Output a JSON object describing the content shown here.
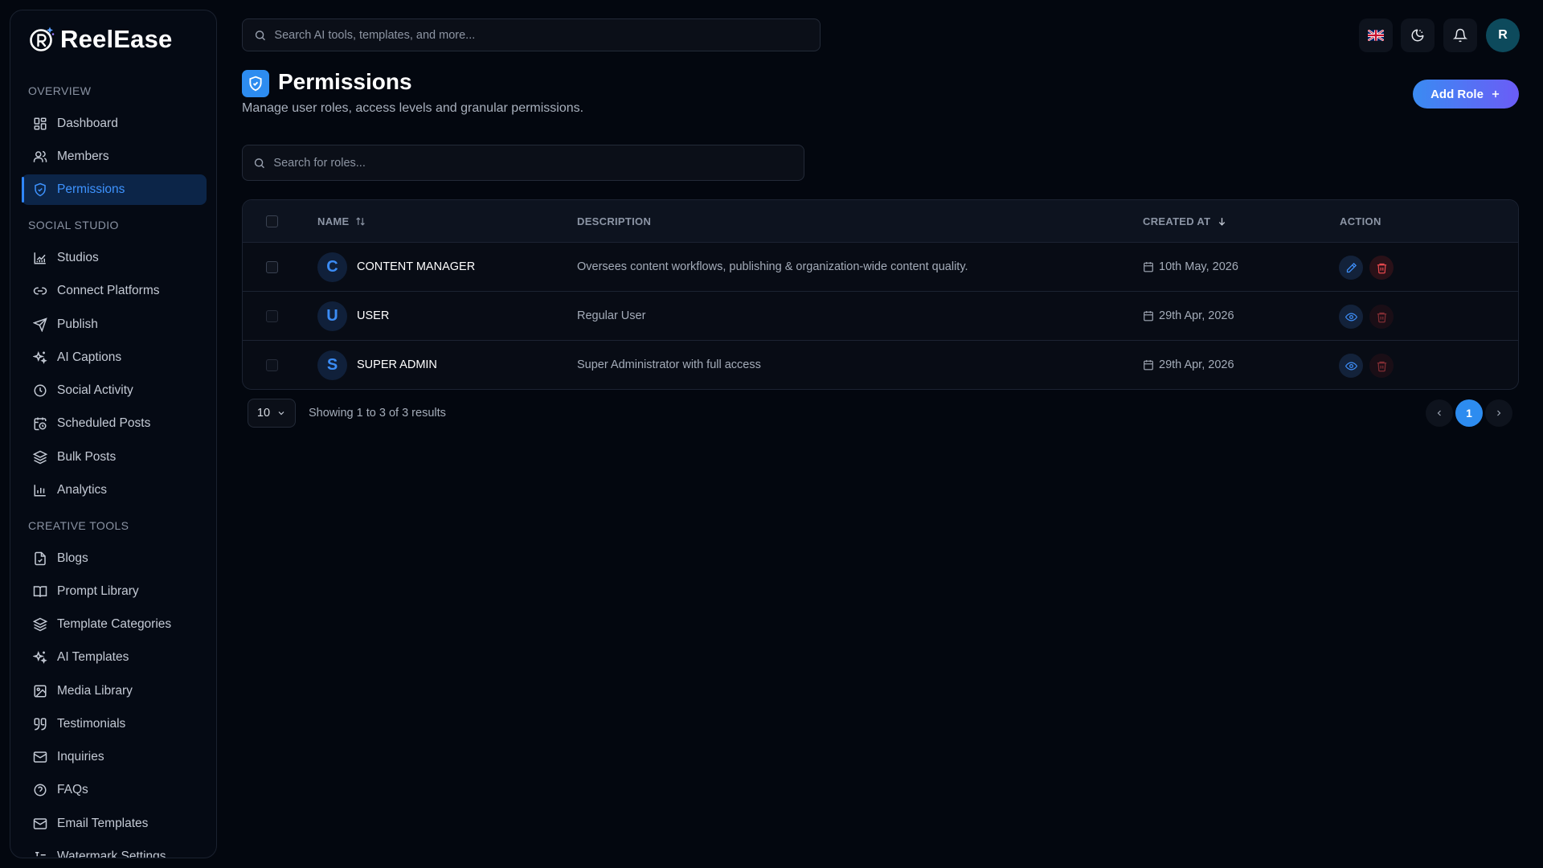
{
  "app": {
    "name": "ReelEase"
  },
  "sidebar": {
    "sections": [
      {
        "title": "OVERVIEW",
        "items": [
          {
            "label": "Dashboard",
            "icon": "dashboard-icon"
          },
          {
            "label": "Members",
            "icon": "users-icon"
          },
          {
            "label": "Permissions",
            "icon": "shield-icon",
            "active": true
          }
        ]
      },
      {
        "title": "SOCIAL STUDIO",
        "items": [
          {
            "label": "Studios",
            "icon": "chart-icon"
          },
          {
            "label": "Connect Platforms",
            "icon": "link-icon"
          },
          {
            "label": "Publish",
            "icon": "send-icon"
          },
          {
            "label": "AI Captions",
            "icon": "sparkles-icon"
          },
          {
            "label": "Social Activity",
            "icon": "clock-icon"
          },
          {
            "label": "Scheduled Posts",
            "icon": "calendar-clock-icon"
          },
          {
            "label": "Bulk Posts",
            "icon": "layers-icon"
          },
          {
            "label": "Analytics",
            "icon": "bar-chart-icon"
          }
        ]
      },
      {
        "title": "CREATIVE TOOLS",
        "items": [
          {
            "label": "Blogs",
            "icon": "file-icon"
          },
          {
            "label": "Prompt Library",
            "icon": "book-icon"
          },
          {
            "label": "Template Categories",
            "icon": "layers-icon"
          },
          {
            "label": "AI Templates",
            "icon": "sparkles-icon"
          },
          {
            "label": "Media Library",
            "icon": "image-icon"
          },
          {
            "label": "Testimonials",
            "icon": "quote-icon"
          },
          {
            "label": "Inquiries",
            "icon": "mail-icon"
          },
          {
            "label": "FAQs",
            "icon": "help-circle-icon"
          },
          {
            "label": "Email Templates",
            "icon": "mail-icon"
          },
          {
            "label": "Watermark Settings",
            "icon": "text-icon"
          }
        ]
      }
    ]
  },
  "header": {
    "search_placeholder": "Search AI tools, templates, and more...",
    "avatar_initial": "R"
  },
  "page": {
    "title": "Permissions",
    "subtitle": "Manage user roles, access levels and granular permissions.",
    "add_button": "Add Role",
    "search_placeholder": "Search for roles..."
  },
  "table": {
    "columns": {
      "name": "NAME",
      "description": "DESCRIPTION",
      "created_at": "CREATED AT",
      "action": "ACTION"
    },
    "rows": [
      {
        "initial": "C",
        "name": "CONTENT MANAGER",
        "description": "Oversees content workflows, publishing & organization-wide content quality.",
        "created_at": "10th May, 2026",
        "primary_action": "edit"
      },
      {
        "initial": "U",
        "name": "USER",
        "description": "Regular User",
        "created_at": "29th Apr, 2026",
        "primary_action": "view"
      },
      {
        "initial": "S",
        "name": "SUPER ADMIN",
        "description": "Super Administrator with full access",
        "created_at": "29th Apr, 2026",
        "primary_action": "view"
      }
    ]
  },
  "pagination": {
    "per_page": "10",
    "summary": "Showing 1 to 3 of 3 results",
    "current_page": "1"
  },
  "colors": {
    "background": "#03070f",
    "accent": "#2d8cf0",
    "active_nav_bg": "#0c2548",
    "danger": "#e5484d"
  }
}
